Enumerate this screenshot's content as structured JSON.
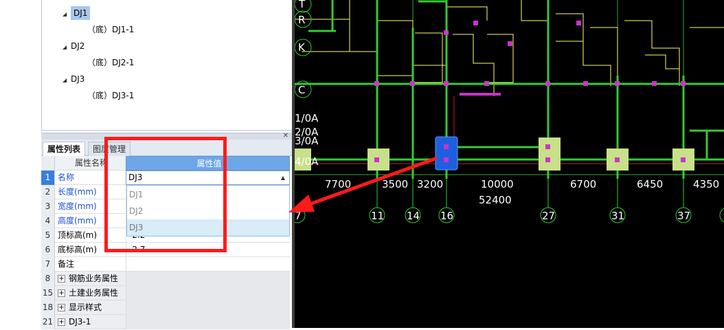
{
  "tree": {
    "items": [
      {
        "label": "DJ1",
        "expanded": true,
        "selected": true
      },
      {
        "label": "（底）DJ1-1"
      },
      {
        "label": "DJ2",
        "expanded": true
      },
      {
        "label": "（底）DJ2-1"
      },
      {
        "label": "DJ3",
        "expanded": true
      },
      {
        "label": "（底）DJ3-1"
      }
    ]
  },
  "tabs": [
    {
      "label": "属性列表",
      "active": true
    },
    {
      "label": "图层管理",
      "active": false
    }
  ],
  "grid": {
    "header": {
      "name": "属性名称",
      "value": "属性值"
    },
    "rows": [
      {
        "num": "1",
        "name": "名称",
        "value": "DJ3"
      },
      {
        "num": "2",
        "name": "长度(mm)",
        "value": ""
      },
      {
        "num": "3",
        "name": "宽度(mm)",
        "value": ""
      },
      {
        "num": "4",
        "name": "高度(mm)",
        "value": ""
      },
      {
        "num": "5",
        "name": "顶标高(m)",
        "value": "-2.2"
      },
      {
        "num": "6",
        "name": "底标高(m)",
        "value": "-2.7"
      },
      {
        "num": "7",
        "name": "备注",
        "value": ""
      },
      {
        "num": "8",
        "name": "钢筋业务属性",
        "value": ""
      },
      {
        "num": "15",
        "name": "土建业务属性",
        "value": ""
      },
      {
        "num": "18",
        "name": "显示样式",
        "value": ""
      },
      {
        "num": "21",
        "name": "DJ3-1",
        "value": ""
      }
    ]
  },
  "dropdown": {
    "current": "DJ3",
    "options": [
      "DJ1",
      "DJ2",
      "DJ3"
    ],
    "hovered": "DJ3"
  },
  "cad": {
    "axis_letters": [
      "T",
      "R",
      "K",
      "C",
      "1/0A",
      "2/0A",
      "3/0A",
      "4/0A"
    ],
    "dimensions": [
      "7700",
      "3500",
      "3200",
      "10000",
      "6700",
      "6450",
      "4350"
    ],
    "total_dimension": "52400",
    "axis_numbers": [
      "7",
      "11",
      "14",
      "16",
      "27",
      "31",
      "37"
    ],
    "colors": {
      "background": "#000000",
      "wall": "#ffff66",
      "beam": "#33cc33",
      "column": "#cc33cc",
      "selected": "#1e5fe0",
      "pad": "#c8e08a",
      "annotation": "#ff1a1a"
    }
  }
}
